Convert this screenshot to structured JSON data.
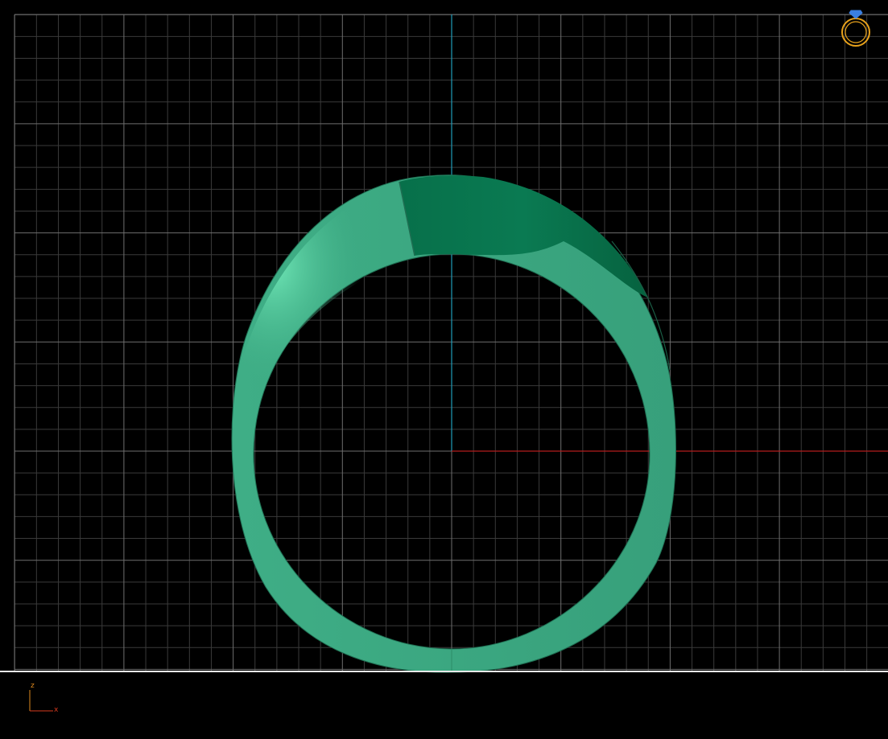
{
  "viewport": {
    "background": "#000000",
    "view_orientation": "front",
    "grid": {
      "visible": true,
      "minor_color": "#3a3a3a",
      "major_color": "#6e6e6e",
      "ground_line_color": "#e8e8e8"
    },
    "world_axes": {
      "vertical_axis_color": "#1e9bb8",
      "horizontal_axis_color": "#b41c1c"
    }
  },
  "model": {
    "name": "ring",
    "material_color": "#3fae86",
    "highlight_color": "#6fe6b6",
    "shadow_color": "#07704a"
  },
  "axis_indicator": {
    "vertical_label": "z",
    "horizontal_label": "x",
    "vertical_color": "#e08a1e",
    "horizontal_color": "#d83a1e"
  },
  "view_cube": {
    "icon": "ring-icon",
    "ring_color": "#e8a21c",
    "gem_color": "#3a7fe0"
  }
}
